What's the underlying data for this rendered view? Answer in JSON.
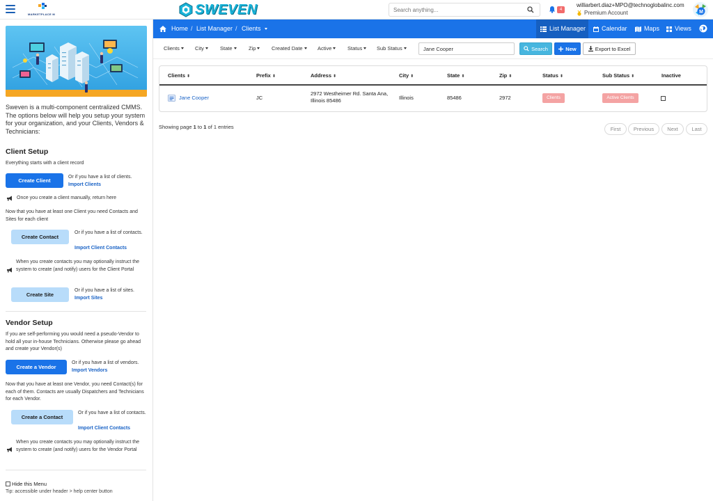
{
  "header": {
    "marketplace_logo_text": "MARKETPLACE M",
    "brand_name": "SWEVEN",
    "search_placeholder": "Search anything...",
    "notification_count": "4",
    "user_email": "williarbert.diaz+MPO@technoglobalinc.com",
    "user_plan": "Premium Account"
  },
  "sidebar": {
    "intro": "Sweven is a multi-component centralized CMMS. The options below will help you setup your system for your organization, and your Clients, Vendors & Technicians:",
    "client_setup": {
      "title": "Client Setup",
      "note1": "Everything starts with a client record",
      "create_client": "Create Client",
      "or_list_clients": "Or if you have a list of clients.",
      "import_clients": "Import Clients",
      "return_note": "Once you create a client manually, return here",
      "note2": "Now that you have at least one Client you need Contacts and Sites for  each client",
      "create_contact": "Create Contact",
      "or_list_contacts": "Or if you have a list of contacts.",
      "import_client_contacts": "Import Client Contacts",
      "portal_note": "When you create contacts you may optionally instruct the system to create (and notify) users for the Client Portal",
      "create_site": "Create Site",
      "or_list_sites": "Or if you have a list of sites.",
      "import_sites": "Import Sites"
    },
    "vendor_setup": {
      "title": "Vendor Setup",
      "note1": "If you are self-performing you would need a pseudo-Vendor to hold all your in-house Technicians. Otherwise please go ahead and create your Vendor(s)",
      "create_vendor": "Create a Vendor",
      "or_list_vendors": "Or if you have a list of vendors.",
      "import_vendors": "Import Vendors",
      "note2": "Now that you have at least one Vendor, you need Contact(s) for each of them. Contacts are usually Dispatchers and Technicians for each Vendor.",
      "create_contact": "Create a Contact",
      "or_list_contacts": "Or if you have a list of contacts.",
      "import_client_contacts": "Import Client Contacts",
      "portal_note": "When you create contacts you may optionally instruct the system to create (and notify) users for the Vendor Portal"
    },
    "hide_menu": "Hide this Menu",
    "tip": "Tip: accessible under header > help center button"
  },
  "navbar": {
    "home": "Home",
    "list_manager": "List Manager",
    "clients": "Clients",
    "tabs": [
      "List Manager",
      "Calendar",
      "Maps",
      "Views"
    ]
  },
  "filters": {
    "items": [
      "Clients",
      "City",
      "State",
      "Zip",
      "Created Date",
      "Active",
      "Status",
      "Sub Status"
    ],
    "search_value": "Jane Cooper",
    "search_button": "Search",
    "new_button": "New",
    "export_button": "Export to Excel"
  },
  "table": {
    "headers": [
      "Clients",
      "Prefix",
      "Address",
      "City",
      "State",
      "Zip",
      "Status",
      "Sub Status",
      "Inactive"
    ],
    "row": {
      "client": "Jane Cooper",
      "prefix": "JC",
      "address": "2972 Westheimer Rd. Santa Ana, Illinois 85486",
      "city": "Illinois",
      "state": "85486",
      "zip": "2972",
      "status": "Clients",
      "sub_status": "Active Clients"
    }
  },
  "footer": {
    "showing_prefix": "Showing page",
    "page_from": "1",
    "to_word": "to",
    "page_to": "1",
    "of_text": "of 1 entries",
    "pager": [
      "First",
      "Previous",
      "Next",
      "Last"
    ]
  },
  "colors": {
    "primary": "#1a73e8",
    "light_button": "#b8dcfa",
    "search_button": "#47b6df",
    "badge": "#f4a3a3",
    "link": "#1a63c6"
  }
}
